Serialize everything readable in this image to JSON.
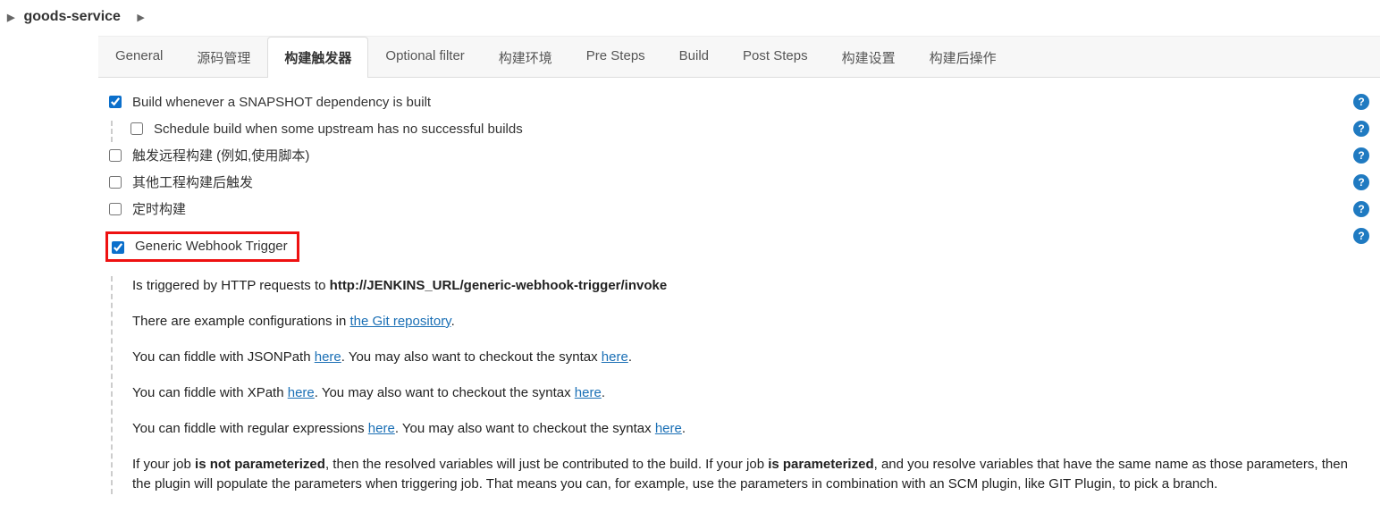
{
  "breadcrumb": {
    "item": "goods-service"
  },
  "tabs": [
    {
      "id": "general",
      "label": "General",
      "active": false
    },
    {
      "id": "scm",
      "label": "源码管理",
      "active": false
    },
    {
      "id": "triggers",
      "label": "构建触发器",
      "active": true
    },
    {
      "id": "optfilter",
      "label": "Optional filter",
      "active": false
    },
    {
      "id": "env",
      "label": "构建环境",
      "active": false
    },
    {
      "id": "presteps",
      "label": "Pre Steps",
      "active": false
    },
    {
      "id": "build",
      "label": "Build",
      "active": false
    },
    {
      "id": "poststeps",
      "label": "Post Steps",
      "active": false
    },
    {
      "id": "settings",
      "label": "构建设置",
      "active": false
    },
    {
      "id": "postbuild",
      "label": "构建后操作",
      "active": false
    }
  ],
  "triggers": {
    "snapshot": {
      "label": "Build whenever a SNAPSHOT dependency is built",
      "checked": true
    },
    "snapshot_sub": {
      "label": "Schedule build when some upstream has no successful builds",
      "checked": false
    },
    "remote": {
      "label": "触发远程构建 (例如,使用脚本)",
      "checked": false
    },
    "after_other": {
      "label": "其他工程构建后触发",
      "checked": false
    },
    "periodic": {
      "label": "定时构建",
      "checked": false
    },
    "generic_webhook": {
      "label": "Generic Webhook Trigger",
      "checked": true
    }
  },
  "webhook_desc": {
    "p1_pre": "Is triggered by HTTP requests to ",
    "p1_url": "http://JENKINS_URL/generic-webhook-trigger/invoke",
    "p2_pre": "There are example configurations in ",
    "p2_link": "the Git repository",
    "p2_post": ".",
    "p3_pre": "You can fiddle with JSONPath ",
    "p3_link1": "here",
    "p3_mid": ". You may also want to checkout the syntax ",
    "p3_link2": "here",
    "p3_post": ".",
    "p4_pre": "You can fiddle with XPath ",
    "p4_link1": "here",
    "p4_mid": ". You may also want to checkout the syntax ",
    "p4_link2": "here",
    "p4_post": ".",
    "p5_pre": "You can fiddle with regular expressions ",
    "p5_link1": "here",
    "p5_mid": ". You may also want to checkout the syntax ",
    "p5_link2": "here",
    "p5_post": ".",
    "p6_a": "If your job ",
    "p6_b1": "is not parameterized",
    "p6_c": ", then the resolved variables will just be contributed to the build. If your job ",
    "p6_b2": "is parameterized",
    "p6_d": ", and you resolve variables that have the same name as those parameters, then the plugin will populate the parameters when triggering job. That means you can, for example, use the parameters in combination with an SCM plugin, like GIT Plugin, to pick a branch."
  },
  "help_glyph": "?"
}
